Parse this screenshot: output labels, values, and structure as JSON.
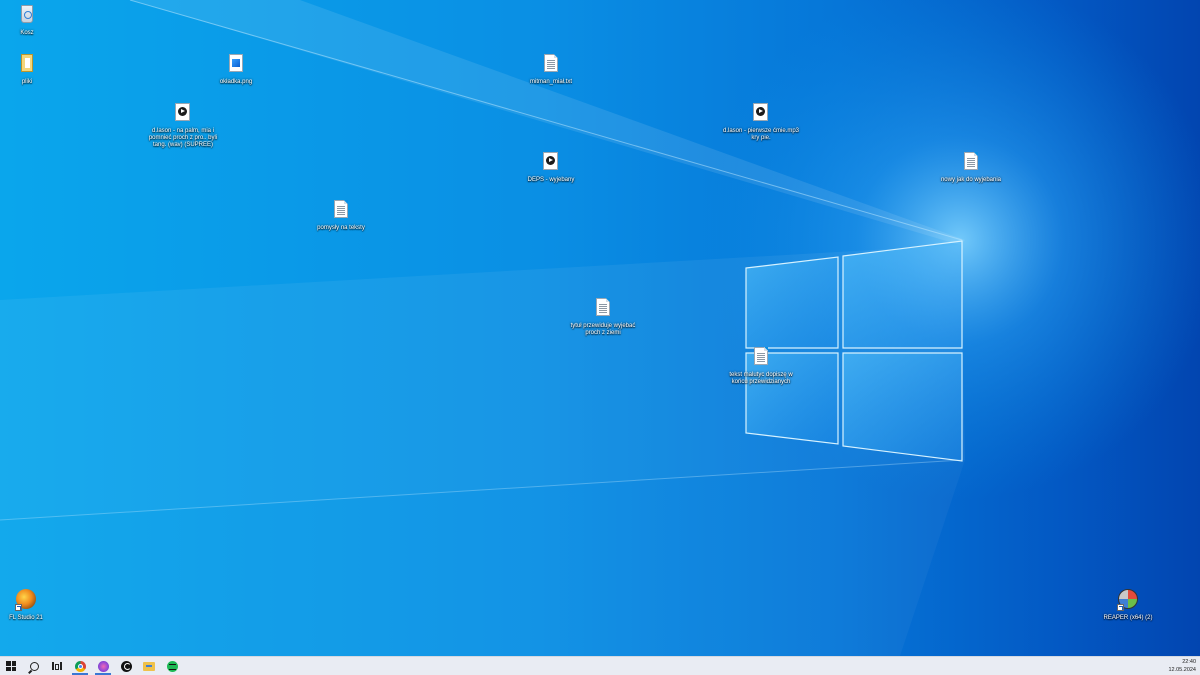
{
  "desktop": {
    "wallpaper": "Windows 10 hero light",
    "icons": [
      {
        "name": "recycle-bin",
        "label": "Kosz",
        "type": "recycle-bin-icon"
      },
      {
        "name": "desktop-file-1",
        "label": "pliki",
        "type": "folder-doc-icon"
      },
      {
        "name": "desktop-file-2",
        "label": "okładka.png",
        "type": "image-file-icon"
      },
      {
        "name": "desktop-file-3",
        "label": "d.lason - na palm, mia i pomnieć proch z pro.. byli tang. (wav) (SUPREE)",
        "type": "media-file-icon"
      },
      {
        "name": "desktop-file-4",
        "label": "pomysły na teksty",
        "type": "text-file-icon"
      },
      {
        "name": "desktop-file-5",
        "label": "mitman_miał.txt",
        "type": "text-file-icon"
      },
      {
        "name": "desktop-file-6",
        "label": "DEPS - wyjebany",
        "type": "media-file-icon"
      },
      {
        "name": "desktop-file-7",
        "label": "d.lason - pierwsze ćmie.mp3 kry pie.",
        "type": "media-file-icon"
      },
      {
        "name": "desktop-file-8",
        "label": "nowy jak do wyjebania",
        "type": "text-file-icon"
      },
      {
        "name": "desktop-file-9",
        "label": "tytuł przewiduje wyjebać proch z ziemi",
        "type": "text-file-icon"
      },
      {
        "name": "desktop-file-10",
        "label": "tekst malutyc dopiszę w końcu przewidzianych",
        "type": "text-file-icon"
      },
      {
        "name": "fl-studio-shortcut",
        "label": "FL Studio 21",
        "type": "fl-studio-icon"
      },
      {
        "name": "reaper-shortcut",
        "label": "REAPER (x64) (2)",
        "type": "reaper-icon"
      }
    ]
  },
  "taskbar": {
    "buttons": [
      {
        "name": "start-button",
        "icon": "windows-logo-icon"
      },
      {
        "name": "search-button",
        "icon": "search-icon"
      },
      {
        "name": "task-view-button",
        "icon": "task-view-icon"
      },
      {
        "name": "chrome-button",
        "icon": "chrome-icon"
      },
      {
        "name": "mixer-app-button",
        "icon": "mixer-app-icon"
      },
      {
        "name": "capcut-button",
        "icon": "capcut-icon"
      },
      {
        "name": "file-explorer-button",
        "icon": "folder-icon"
      },
      {
        "name": "spotify-button",
        "icon": "spotify-icon"
      }
    ],
    "clock": {
      "time": "22:40",
      "date": "12.05.2024"
    }
  },
  "colors": {
    "taskbar_bg": "#e9ecf3",
    "accent": "#3a78d4",
    "wallpaper_light": "#0aa6ec",
    "wallpaper_dark": "#0245b0"
  }
}
